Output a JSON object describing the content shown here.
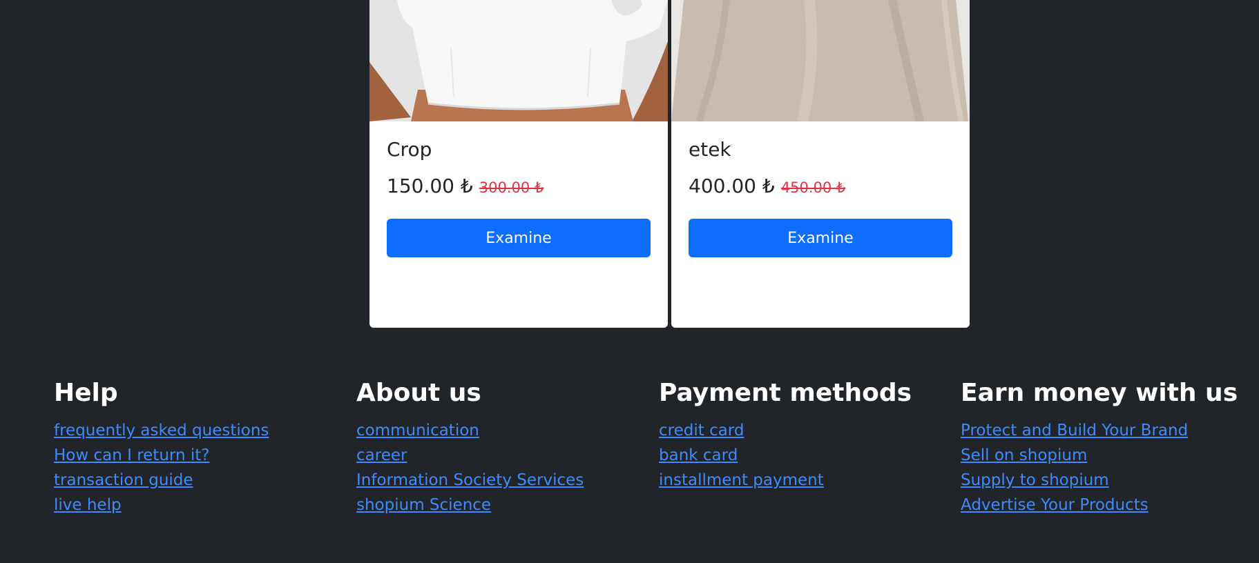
{
  "products": [
    {
      "image_icon": "crop-top-photo",
      "title": "Crop",
      "price": "150.00 ₺",
      "old_price": "300.00 ₺",
      "button_label": "Examine"
    },
    {
      "image_icon": "skirt-photo",
      "title": "etek",
      "price": "400.00 ₺",
      "old_price": "450.00 ₺",
      "button_label": "Examine"
    }
  ],
  "footer": {
    "columns": [
      {
        "heading": "Help",
        "links": [
          "frequently asked questions",
          "How can I return it?",
          "transaction guide",
          "live help"
        ]
      },
      {
        "heading": "About us",
        "links": [
          "communication",
          "career",
          "Information Society Services",
          "shopium Science"
        ]
      },
      {
        "heading": "Payment methods",
        "links": [
          "credit card",
          "bank card",
          "installment payment"
        ]
      },
      {
        "heading": "Earn money with us",
        "links": [
          "Protect and Build Your Brand",
          "Sell on shopium",
          "Supply to shopium",
          "Advertise Your Products"
        ]
      }
    ]
  },
  "colors": {
    "background": "#212529",
    "primary_button": "#0d6efd",
    "link": "#3d8bfd",
    "old_price": "#dc3545"
  }
}
